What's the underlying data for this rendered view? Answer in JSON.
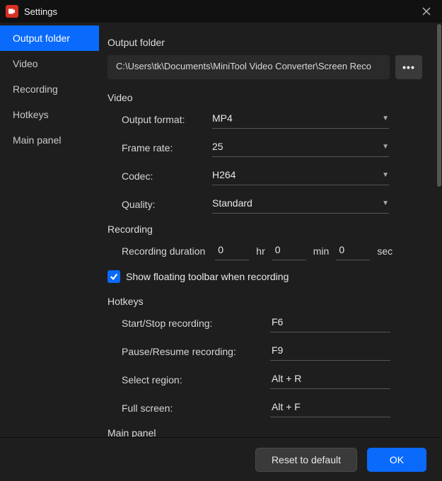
{
  "titlebar": {
    "title": "Settings"
  },
  "sidebar": {
    "items": [
      {
        "label": "Output folder",
        "active": true
      },
      {
        "label": "Video"
      },
      {
        "label": "Recording"
      },
      {
        "label": "Hotkeys"
      },
      {
        "label": "Main panel"
      }
    ]
  },
  "output_folder": {
    "heading": "Output folder",
    "path": "C:\\Users\\tk\\Documents\\MiniTool Video Converter\\Screen Reco",
    "browse_glyph": "•••"
  },
  "video": {
    "heading": "Video",
    "output_format": {
      "label": "Output format:",
      "value": "MP4"
    },
    "frame_rate": {
      "label": "Frame rate:",
      "value": "25"
    },
    "codec": {
      "label": "Codec:",
      "value": "H264"
    },
    "quality": {
      "label": "Quality:",
      "value": "Standard"
    }
  },
  "recording": {
    "heading": "Recording",
    "duration_label": "Recording duration",
    "hr_value": "0",
    "hr_unit": "hr",
    "min_value": "0",
    "min_unit": "min",
    "sec_value": "0",
    "sec_unit": "sec",
    "checkbox_label": "Show floating toolbar when recording",
    "checkbox_checked": true
  },
  "hotkeys": {
    "heading": "Hotkeys",
    "start_stop": {
      "label": "Start/Stop recording:",
      "value": "F6"
    },
    "pause_resume": {
      "label": "Pause/Resume recording:",
      "value": "F9"
    },
    "select_region": {
      "label": "Select region:",
      "value": "Alt + R"
    },
    "full_screen": {
      "label": "Full screen:",
      "value": "Alt + F"
    }
  },
  "main_panel": {
    "heading": "Main panel"
  },
  "footer": {
    "reset_label": "Reset to default",
    "ok_label": "OK"
  }
}
